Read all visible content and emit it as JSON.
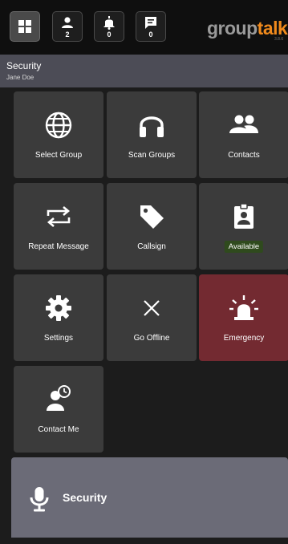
{
  "toolbar": {
    "users_count": "2",
    "alerts_count": "0",
    "messages_count": "0"
  },
  "logo": {
    "part1": "group",
    "part2": "talk",
    "sub": "3.8.6"
  },
  "header": {
    "title": "Security",
    "subtitle": "Jane Doe"
  },
  "tiles": [
    {
      "label": "Select Group",
      "icon": "globe-icon"
    },
    {
      "label": "Scan Groups",
      "icon": "headphones-icon"
    },
    {
      "label": "Contacts",
      "icon": "contacts-icon"
    },
    {
      "label": "Repeat Message",
      "icon": "repeat-icon"
    },
    {
      "label": "Callsign",
      "icon": "tag-icon"
    },
    {
      "label": "Available",
      "icon": "badge-icon"
    },
    {
      "label": "Settings",
      "icon": "gear-icon"
    },
    {
      "label": "Go Offline",
      "icon": "close-icon"
    },
    {
      "label": "Emergency",
      "icon": "siren-icon"
    },
    {
      "label": "Contact Me",
      "icon": "contact-me-icon"
    }
  ],
  "ptt": {
    "label": "Security",
    "icon": "microphone-icon"
  },
  "colors": {
    "accent": "#f08a1c",
    "emergency": "#732a31",
    "available_badge": "#2f4a1d"
  }
}
